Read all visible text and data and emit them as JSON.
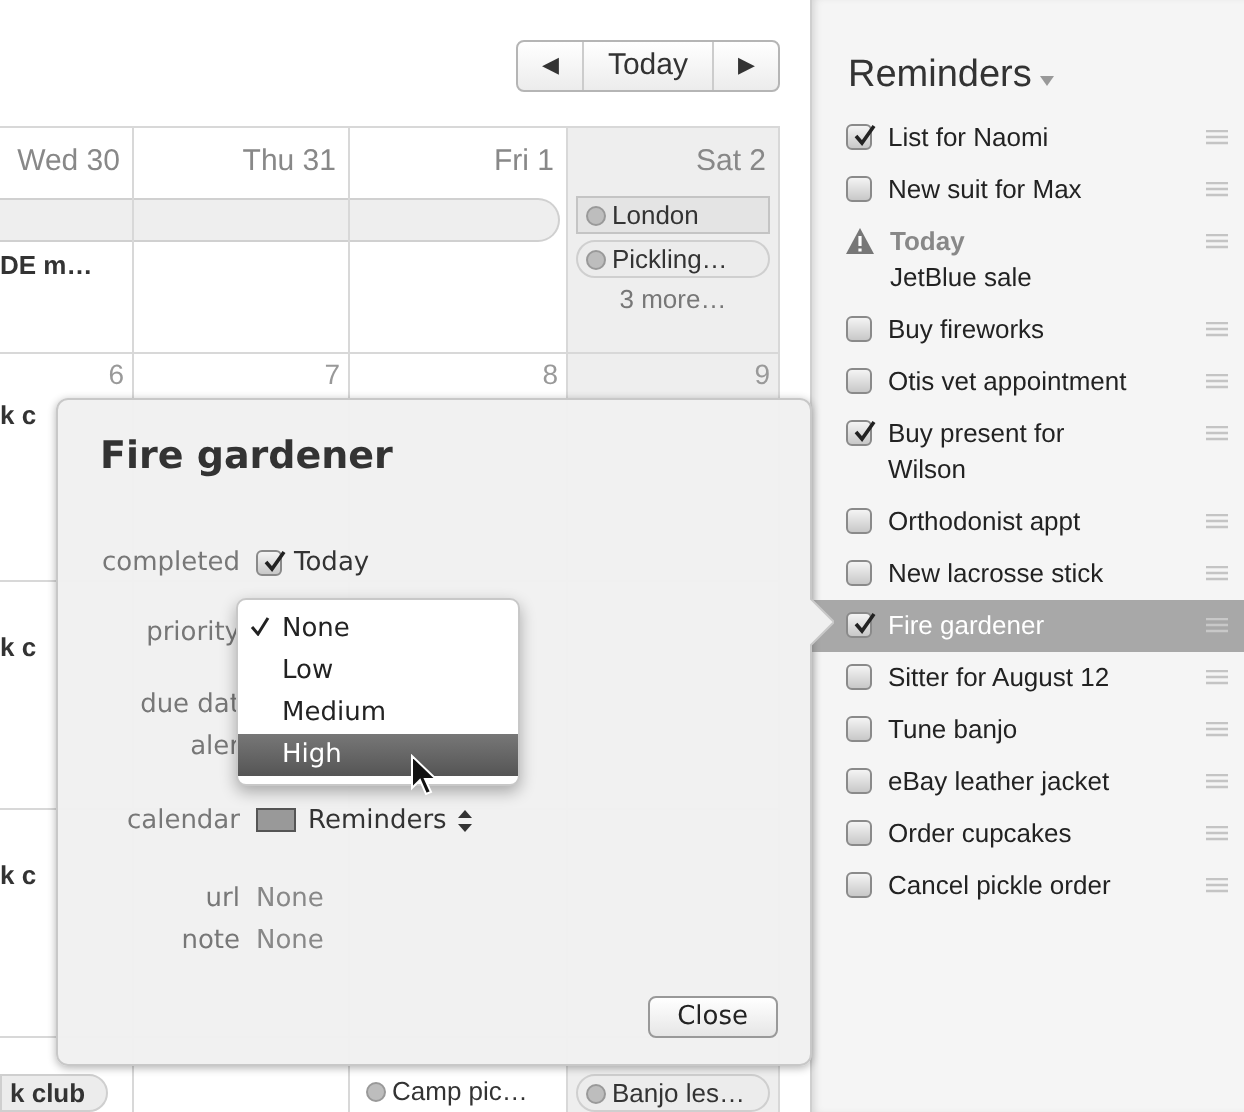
{
  "toolbar": {
    "prev": "◀",
    "today": "Today",
    "next": "▶"
  },
  "calendar": {
    "day_headers": [
      {
        "label": "Wed 30",
        "weekend": false
      },
      {
        "label": "Thu 31",
        "weekend": false
      },
      {
        "label": "Fri 1",
        "weekend": false
      },
      {
        "label": "Sat 2",
        "weekend": true
      }
    ],
    "weeks": [
      {
        "all_day_bar": true,
        "cells": [
          {
            "events": [
              {
                "kind": "text",
                "title": "DE m…"
              }
            ]
          },
          {},
          {},
          {
            "events": [
              {
                "kind": "box",
                "title": "London"
              },
              {
                "kind": "pill",
                "title": "Pickling…"
              },
              {
                "kind": "more",
                "title": "3 more…"
              }
            ]
          }
        ]
      },
      {
        "all_day_bar": false,
        "cells": [
          {
            "date": "6",
            "events": [
              {
                "kind": "text",
                "title": "k c"
              }
            ]
          },
          {
            "date": "7"
          },
          {
            "date": "8"
          },
          {
            "date": "9"
          }
        ]
      },
      {
        "all_day_bar": false,
        "cells": [
          {
            "events": [
              {
                "kind": "text",
                "title": "k c"
              }
            ]
          },
          {},
          {},
          {}
        ]
      },
      {
        "all_day_bar": false,
        "cells": [
          {
            "events": [
              {
                "kind": "text",
                "title": "k c"
              }
            ]
          },
          {},
          {},
          {}
        ]
      },
      {
        "all_day_bar": false,
        "cells": [
          {
            "events": [
              {
                "kind": "pill",
                "title": "k club"
              }
            ]
          },
          {},
          {
            "events": [
              {
                "kind": "dot",
                "title": "Camp pic…"
              }
            ]
          },
          {
            "events": [
              {
                "kind": "pill",
                "title": "Banjo les…"
              }
            ]
          }
        ]
      }
    ]
  },
  "popover": {
    "title": "Fire gardener",
    "completed": {
      "label": "completed",
      "checked": true,
      "value": "Today"
    },
    "priority": {
      "label": "priority",
      "options": [
        {
          "label": "None",
          "selected": true,
          "highlighted": false
        },
        {
          "label": "Low",
          "selected": false,
          "highlighted": false
        },
        {
          "label": "Medium",
          "selected": false,
          "highlighted": false
        },
        {
          "label": "High",
          "selected": false,
          "highlighted": true
        }
      ]
    },
    "due_date": {
      "label": "due dat"
    },
    "alert": {
      "label": "aler"
    },
    "calendar": {
      "label": "calendar",
      "value": "Reminders"
    },
    "url": {
      "label": "url",
      "value": "None"
    },
    "note": {
      "label": "note",
      "value": "None"
    },
    "close": "Close"
  },
  "sidebar": {
    "title": "Reminders",
    "items": [
      {
        "kind": "task",
        "title": "List for Naomi",
        "checked": true,
        "selected": false
      },
      {
        "kind": "task",
        "title": "New suit for Max",
        "checked": false,
        "selected": false
      },
      {
        "kind": "overdue",
        "due": "Today",
        "title": "JetBlue sale",
        "selected": false
      },
      {
        "kind": "task",
        "title": "Buy fireworks",
        "checked": false,
        "selected": false
      },
      {
        "kind": "task",
        "title": "Otis vet appointment",
        "checked": false,
        "selected": false
      },
      {
        "kind": "task",
        "title": "Buy present for Wilson",
        "checked": true,
        "selected": false
      },
      {
        "kind": "task",
        "title": "Orthodonist appt",
        "checked": false,
        "selected": false
      },
      {
        "kind": "task",
        "title": "New lacrosse stick",
        "checked": false,
        "selected": false
      },
      {
        "kind": "task",
        "title": "Fire gardener",
        "checked": true,
        "selected": true
      },
      {
        "kind": "task",
        "title": "Sitter for August 12",
        "checked": false,
        "selected": false
      },
      {
        "kind": "task",
        "title": "Tune banjo",
        "checked": false,
        "selected": false
      },
      {
        "kind": "task",
        "title": "eBay leather jacket",
        "checked": false,
        "selected": false
      },
      {
        "kind": "task",
        "title": "Order cupcakes",
        "checked": false,
        "selected": false
      },
      {
        "kind": "task",
        "title": "Cancel pickle order",
        "checked": false,
        "selected": false
      }
    ]
  }
}
